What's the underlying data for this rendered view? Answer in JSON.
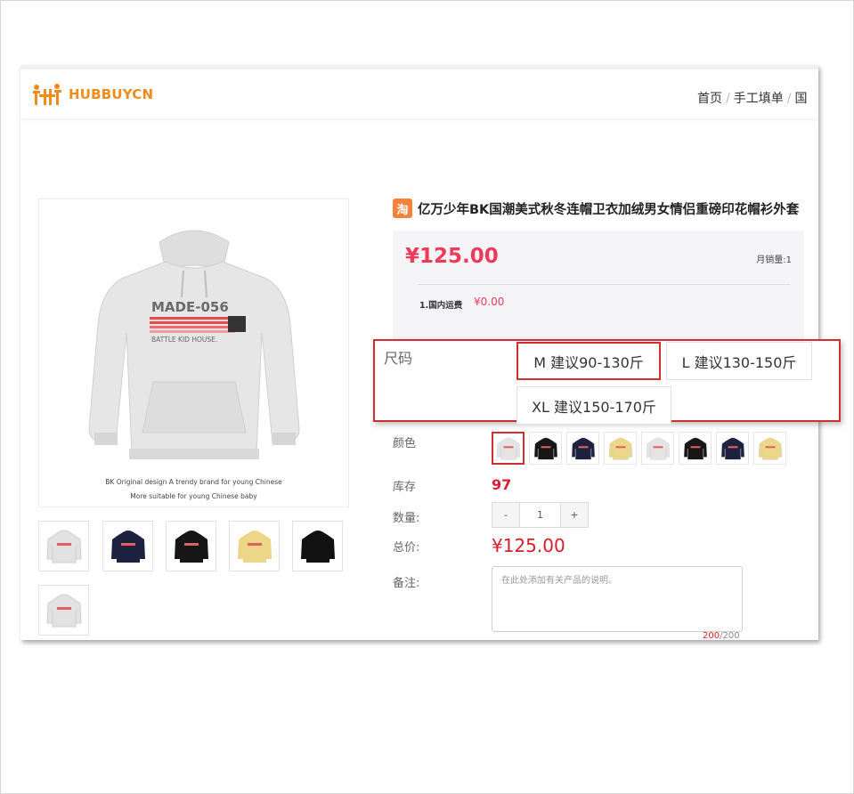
{
  "brand": {
    "name": "HUBBUYCN",
    "color": "#f08c1a"
  },
  "breadcrumb": [
    "首页",
    "手工填单",
    "国"
  ],
  "product": {
    "source_icon": "淘",
    "title": "亿万少年BK国潮美式秋冬连帽卫衣加绒男女情侣重磅印花帽衫外套",
    "price": "¥125.00",
    "monthly_sales": "月销量:1",
    "shipping_label": "1.国内运费",
    "shipping_value": "¥0.00",
    "image_caption_1": "BK Original design A trendy brand for young Chinese",
    "image_caption_2": "More suitable for young Chinese baby",
    "graphic_text_1": "MADE-056",
    "graphic_text_2": "BATTLE KID HOUSE."
  },
  "gallery": {
    "thumbnails": [
      "light-grey",
      "navy",
      "black",
      "yellow",
      "black-plain",
      "light-grey-2"
    ]
  },
  "size": {
    "label": "尺码",
    "options": [
      "M 建议90-130斤",
      "L 建议130-150斤",
      "XL 建议150-170斤"
    ],
    "selected": "M 建议90-130斤"
  },
  "color": {
    "label": "颜色",
    "swatches": [
      "light-grey",
      "black",
      "navy",
      "yellow",
      "light-grey",
      "black",
      "navy",
      "yellow"
    ],
    "selected_index": 0
  },
  "stock": {
    "label": "库存",
    "value": "97"
  },
  "quantity": {
    "label": "数量:",
    "minus": "-",
    "value": "1",
    "plus": "+"
  },
  "total": {
    "label": "总价:",
    "value": "¥125.00"
  },
  "note": {
    "label": "备注:",
    "placeholder": "在此处添加有关产品的说明。",
    "used": "200",
    "max": "/200"
  },
  "colors": {
    "accent_red": "#d32f2f",
    "price_pink": "#ef3b5b",
    "hoodie_grey": "#e4e4e4",
    "hoodie_navy": "#1d2240",
    "hoodie_black": "#161616",
    "hoodie_yellow": "#ecd687"
  }
}
